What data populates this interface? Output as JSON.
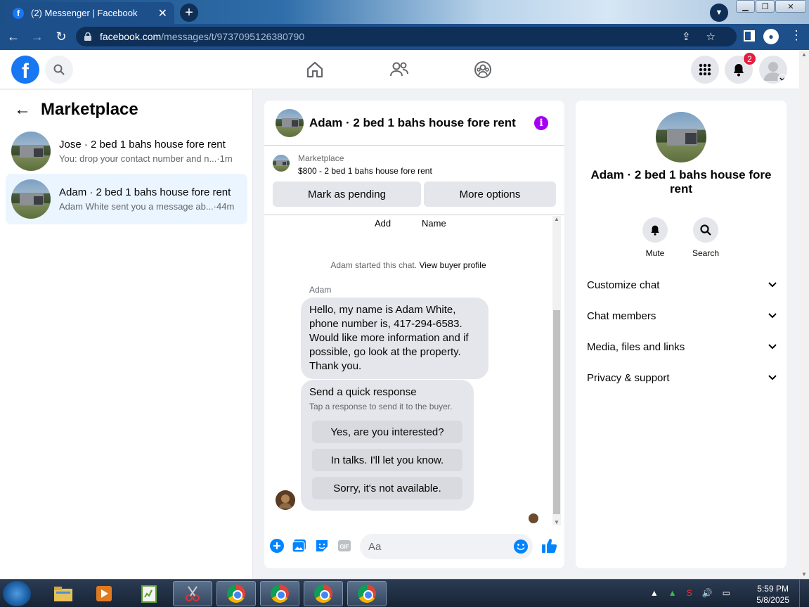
{
  "browser": {
    "tab_title": "(2) Messenger | Facebook",
    "url_host": "facebook.com",
    "url_path": "/messages/t/9737095126380790"
  },
  "fbnav": {
    "notification_count": "2"
  },
  "left": {
    "heading": "Marketplace",
    "conversations": [
      {
        "name": "Jose · 2 bed 1 bahs house fore rent",
        "snippet": "You: drop your contact number and n...",
        "time": "·1m",
        "active": false
      },
      {
        "name": "Adam · 2 bed 1 bahs house fore rent",
        "snippet": "Adam White sent you a message ab...",
        "time": "·44m",
        "active": true
      }
    ]
  },
  "chat": {
    "title": "Adam · 2 bed 1 bahs house fore rent",
    "listing_label": "Marketplace",
    "listing_price": "$800 - 2 bed 1 bahs house fore rent",
    "mark_pending": "Mark as pending",
    "more_options": "More options",
    "quick_add": "Add",
    "quick_name": "Name",
    "system_text": "Adam started this chat.",
    "system_link": "View buyer profile",
    "sender": "Adam",
    "message": "Hello, my name is Adam White, phone number is, 417-294-6583. Would like more information and if possible, go look at the property. Thank you.",
    "quick_title": "Send a quick response",
    "quick_sub": "Tap a response to send it to the buyer.",
    "quick_options": [
      "Yes, are you interested?",
      "In talks. I'll let you know.",
      "Sorry, it's not available."
    ],
    "composer_placeholder": "Aa"
  },
  "info": {
    "title": "Adam · 2 bed 1 bahs house fore rent",
    "mute": "Mute",
    "search": "Search",
    "rows": [
      "Customize chat",
      "Chat members",
      "Media, files and links",
      "Privacy & support"
    ]
  },
  "taskbar": {
    "time": "5:59 PM",
    "date": "5/8/2025"
  },
  "colors": {
    "facebook_blue": "#1877f2",
    "messenger_blue": "#0084ff",
    "info_purple": "#a200f2",
    "badge_red": "#e41e3f"
  }
}
